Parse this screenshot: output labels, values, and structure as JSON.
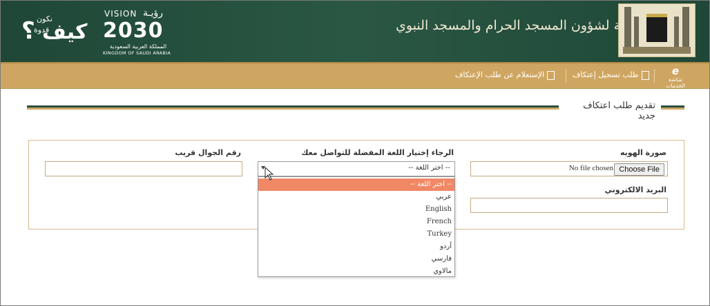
{
  "header": {
    "slogan_line1": "نكون",
    "slogan_line2": "قدوة",
    "slogan_big": "كيف",
    "slogan_mark": "؟",
    "vision_en": "VISION",
    "vision_ar": "رؤيـة",
    "vision_year": "2030",
    "kingdom_ar": "المملكة العربية السعودية",
    "kingdom_en": "KINGDOM OF SAUDI ARABIA",
    "agency_name": "الرئاسة العامة لشؤون المسجد الحرام والمسجد النبوي"
  },
  "navbar": {
    "home_label": "شاشة الخدمات",
    "items": [
      {
        "label": "طلب تسجيل إعتكاف"
      },
      {
        "label": "الإستعلام عن طلب الإعتكاف"
      }
    ]
  },
  "section": {
    "title": "تقديم طلب اعتكاف جديد"
  },
  "form": {
    "id_photo_label": "صورة الهويه",
    "file_button": "Choose File",
    "file_status": "No file chosen",
    "language_label": "الرجاء إختيار اللغة المفضلة للتواصل معك",
    "language_selected": "-- اختر اللغة --",
    "relative_mobile_label": "رقم الجوال قريب",
    "email_label": "البريد الالكتروني",
    "language_options": [
      "-- اختر اللغة --",
      "عربي",
      "English",
      "French",
      "Turkey",
      "أردو",
      "فارسي",
      "مالاوي"
    ]
  },
  "colors": {
    "header_green": "#224c3a",
    "nav_gold": "#cfa661",
    "highlight_option": "#f08866"
  }
}
